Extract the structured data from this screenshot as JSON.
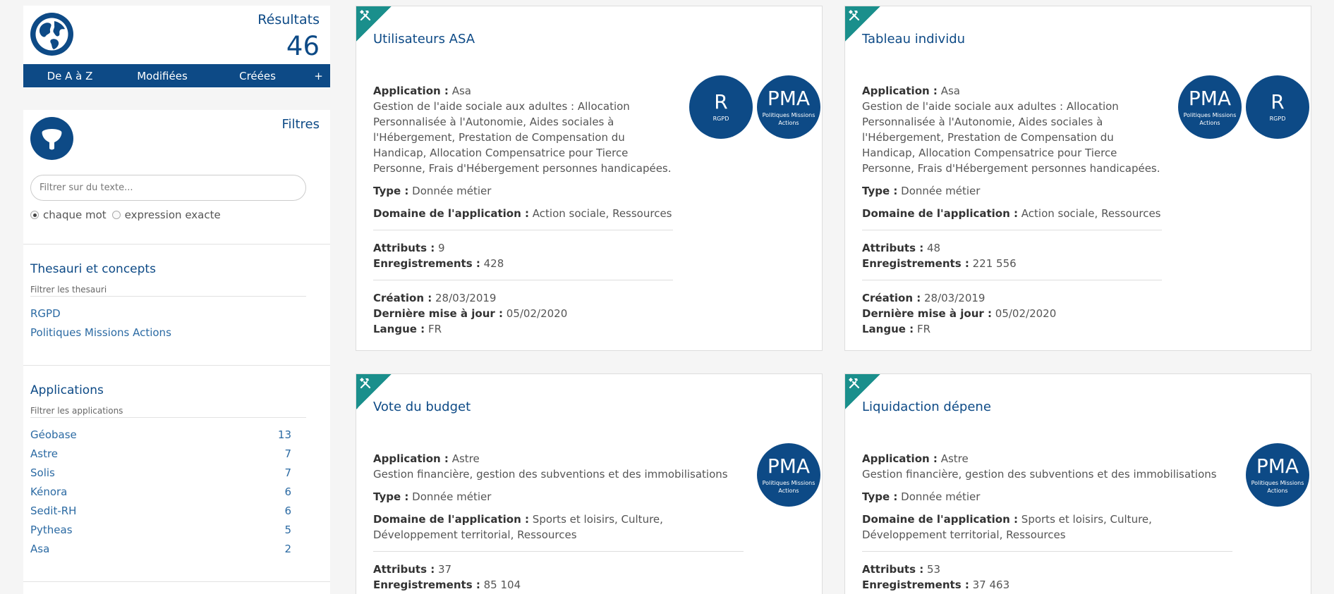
{
  "results": {
    "label": "Résultats",
    "count": "46"
  },
  "sort": {
    "az": "De A à Z",
    "modified": "Modifiées",
    "created": "Créées",
    "more": "+"
  },
  "filters": {
    "label": "Filtres",
    "placeholder": "Filtrer sur du texte...",
    "radio_each_word": "chaque mot",
    "radio_exact": "expression exacte"
  },
  "thesauri": {
    "title": "Thesauri et concepts",
    "filter_label": "Filtrer les thesauri",
    "items": [
      "RGPD",
      "Politiques Missions Actions"
    ]
  },
  "applications": {
    "title": "Applications",
    "filter_label": "Filtrer les applications",
    "items": [
      {
        "name": "Géobase",
        "count": "13"
      },
      {
        "name": "Astre",
        "count": "7"
      },
      {
        "name": "Solis",
        "count": "7"
      },
      {
        "name": "Kénora",
        "count": "6"
      },
      {
        "name": "Sedit-RH",
        "count": "6"
      },
      {
        "name": "Pytheas",
        "count": "5"
      },
      {
        "name": "Asa",
        "count": "2"
      }
    ]
  },
  "labels": {
    "application": "Application :",
    "type": "Type :",
    "domain": "Domaine de l'application :",
    "attributes": "Attributs :",
    "records": "Enregistrements :",
    "creation": "Création :",
    "last_update": "Dernière mise à jour :",
    "language": "Langue :"
  },
  "badge_names": {
    "R": {
      "big": "R",
      "small": "RGPD"
    },
    "PMA": {
      "big": "PMA",
      "small": "Politiques Missions Actions"
    }
  },
  "cards": [
    {
      "title": "Utilisateurs ASA",
      "application": "Asa",
      "description": "Gestion de l'aide sociale aux adultes : Allocation Personnalisée à l'Autonomie, Aides sociales à l'Hébergement, Prestation de Compensation du Handicap, Allocation Compensatrice pour Tierce Personne, Frais d'Hébergement personnes handicapées.",
      "type": "Donnée métier",
      "domain": "Action sociale, Ressources",
      "attributes": "9",
      "records": "428",
      "creation": "28/03/2019",
      "last_update": "05/02/2020",
      "language": "FR"
    },
    {
      "title": "Tableau individu",
      "application": "Asa",
      "description": "Gestion de l'aide sociale aux adultes : Allocation Personnalisée à l'Autonomie, Aides sociales à l'Hébergement, Prestation de Compensation du Handicap, Allocation Compensatrice pour Tierce Personne, Frais d'Hébergement personnes handicapées.",
      "type": "Donnée métier",
      "domain": "Action sociale, Ressources",
      "attributes": "48",
      "records": "221 556",
      "creation": "28/03/2019",
      "last_update": "05/02/2020",
      "language": "FR"
    },
    {
      "title": "Vote du budget",
      "application": "Astre",
      "description": "Gestion financière, gestion des subventions et des immobilisations",
      "type": "Donnée métier",
      "domain": "Sports et loisirs, Culture, Développement territorial, Ressources",
      "attributes": "37",
      "records": "85 104"
    },
    {
      "title": "Liquidaction dépene",
      "application": "Astre",
      "description": "Gestion financière, gestion des subventions et des immobilisations",
      "type": "Donnée métier",
      "domain": "Sports et loisirs, Culture, Développement territorial, Ressources",
      "attributes": "53",
      "records": "37 463"
    }
  ],
  "colors": {
    "primary": "#0d4a86",
    "teal": "#1a8f8c",
    "link": "#2b6aa3"
  }
}
